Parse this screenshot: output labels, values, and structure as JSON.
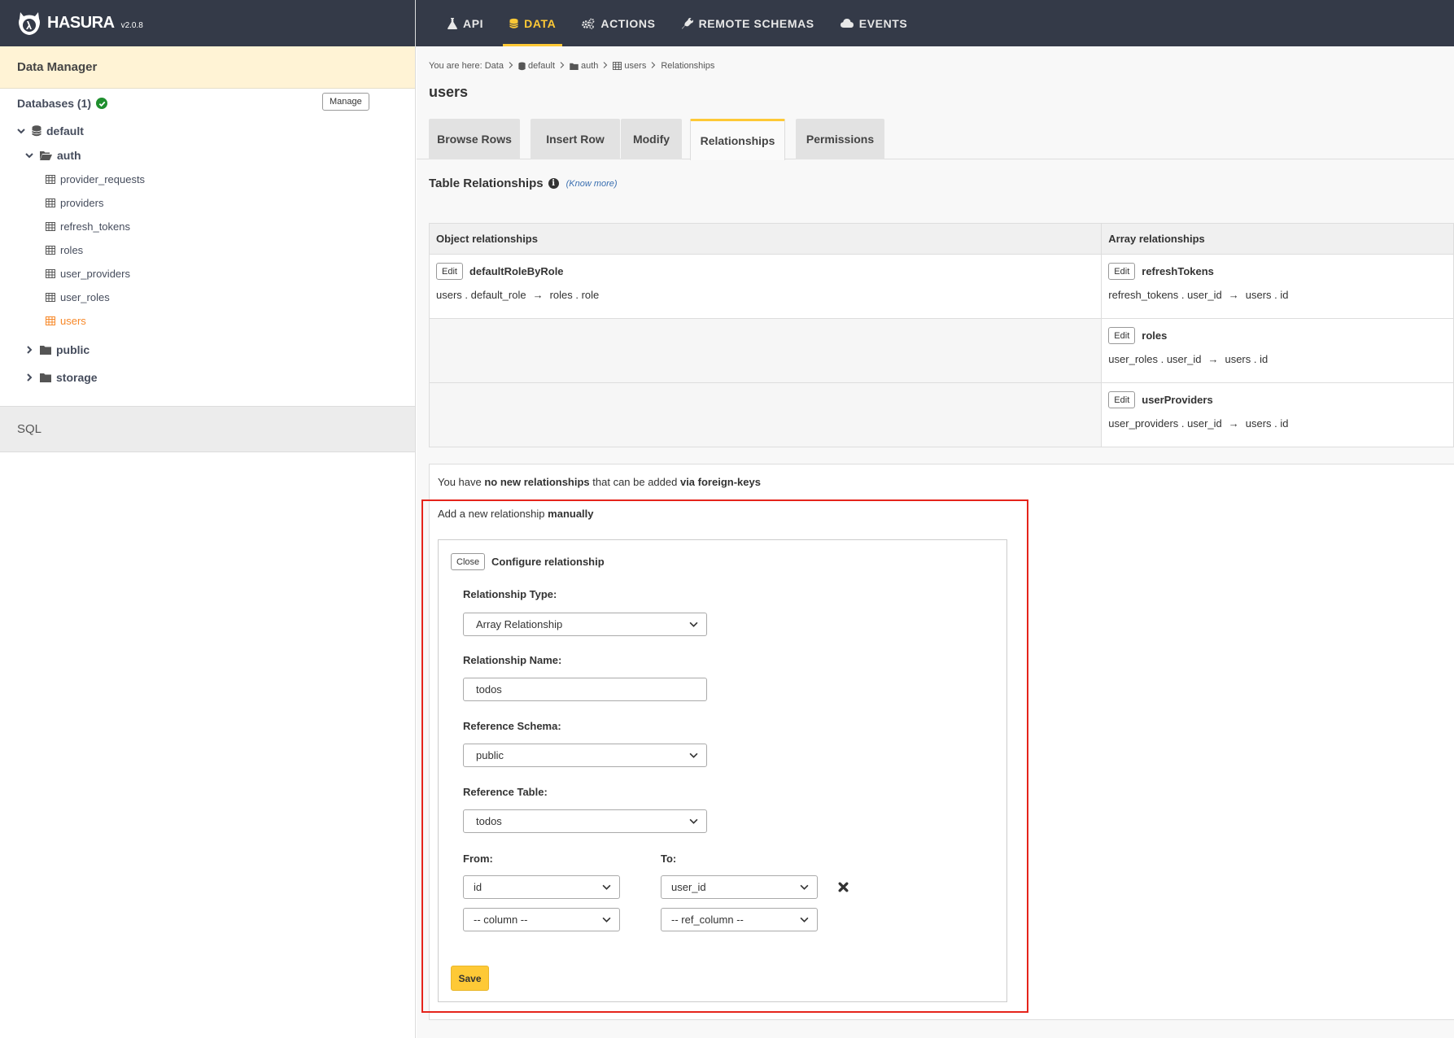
{
  "brand": {
    "name": "HASURA",
    "version": "v2.0.8"
  },
  "nav": [
    {
      "label": "API",
      "icon": "flask-icon",
      "active": false
    },
    {
      "label": "DATA",
      "icon": "database-icon",
      "active": true
    },
    {
      "label": "ACTIONS",
      "icon": "gears-icon",
      "active": false
    },
    {
      "label": "REMOTE SCHEMAS",
      "icon": "plug-icon",
      "active": false
    },
    {
      "label": "EVENTS",
      "icon": "cloud-icon",
      "active": false
    }
  ],
  "sidebar": {
    "header": "Data Manager",
    "databases_label": "Databases (1)",
    "manage_label": "Manage",
    "db_name": "default",
    "schema_auth": "auth",
    "tables": [
      "provider_requests",
      "providers",
      "refresh_tokens",
      "roles",
      "user_providers",
      "user_roles",
      "users"
    ],
    "active_table": "users",
    "schema_public": "public",
    "schema_storage": "storage",
    "sql_label": "SQL"
  },
  "breadcrumb": {
    "prefix": "You are here:",
    "items": [
      "Data",
      "default",
      "auth",
      "users",
      "Relationships"
    ]
  },
  "page_title": "users",
  "tabs": [
    "Browse Rows",
    "Insert Row",
    "Modify",
    "Relationships",
    "Permissions"
  ],
  "active_tab": "Relationships",
  "relationships": {
    "title": "Table Relationships",
    "know_more": "(Know more)",
    "edit_label": "Edit",
    "object_header": "Object relationships",
    "array_header": "Array relationships",
    "object": [
      {
        "name": "defaultRoleByRole",
        "from": "users . default_role",
        "to": "roles . role"
      }
    ],
    "array": [
      {
        "name": "refreshTokens",
        "from": "refresh_tokens . user_id",
        "to": "users . id"
      },
      {
        "name": "roles",
        "from": "user_roles . user_id",
        "to": "users . id"
      },
      {
        "name": "userProviders",
        "from": "user_providers . user_id",
        "to": "users . id"
      }
    ],
    "arrow": "→"
  },
  "fk_note": {
    "p1": "You have ",
    "b1": "no new relationships",
    "p2": " that can be added ",
    "b2": "via foreign-keys"
  },
  "manual": {
    "p1": "Add a new relationship ",
    "b1": "manually",
    "close_label": "Close",
    "config_title": "Configure relationship",
    "type_label": "Relationship Type:",
    "type_value": "Array Relationship",
    "name_label": "Relationship Name:",
    "name_value": "todos",
    "schema_label": "Reference Schema:",
    "schema_value": "public",
    "table_label": "Reference Table:",
    "table_value": "todos",
    "from_label": "From:",
    "to_label": "To:",
    "from_value_1": "id",
    "to_value_1": "user_id",
    "from_value_2": "-- column --",
    "to_value_2": "-- ref_column --",
    "save_label": "Save"
  },
  "colors": {
    "nav_bg": "#343a48",
    "accent": "#fec936",
    "active_table": "#f78828",
    "highlight": "#e5241b",
    "db_ok": "#1f8f2e"
  }
}
